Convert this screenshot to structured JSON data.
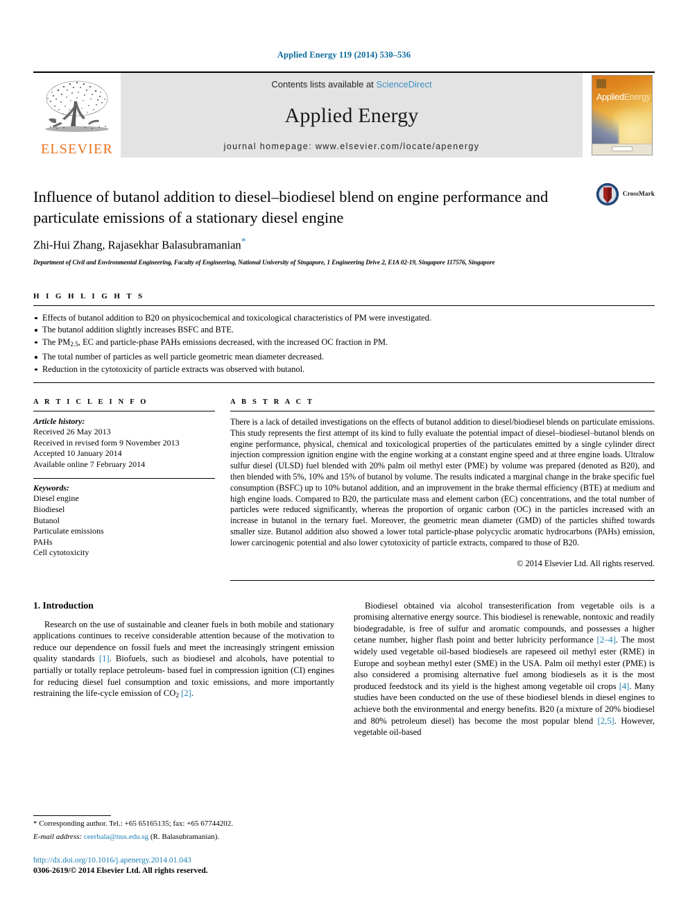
{
  "journal_ref": "Applied Energy 119 (2014) 530–536",
  "masthead": {
    "elsevier_wordmark": "ELSEVIER",
    "contents_prefix": "Contents lists available at ",
    "sciencedirect": "ScienceDirect",
    "journal_title": "Applied Energy",
    "homepage": "journal homepage: www.elsevier.com/locate/apenergy",
    "cover_title_a": "Applied",
    "cover_title_b": "Energy"
  },
  "article": {
    "title": "Influence of butanol addition to diesel–biodiesel blend on engine performance and particulate emissions of a stationary diesel engine",
    "authors": "Zhi-Hui Zhang, Rajasekhar Balasubramanian",
    "corresponding_mark": "*",
    "affiliation": "Department of Civil and Environmental Engineering, Faculty of Engineering, National University of Singapore, 1 Engineering Drive 2, E1A 02-19, Singapore 117576, Singapore",
    "crossmark_label": "CrossMark"
  },
  "highlights": {
    "heading": "H I G H L I G H T S",
    "items": [
      "Effects of butanol addition to B20 on physicochemical and toxicological characteristics of PM were investigated.",
      "The butanol addition slightly increases BSFC and BTE.",
      "The PM2.5, EC and particle-phase PAHs emissions decreased, with the increased OC fraction in PM.",
      "The total number of particles as well particle geometric mean diameter decreased.",
      "Reduction in the cytotoxicity of particle extracts was observed with butanol."
    ]
  },
  "article_info": {
    "heading": "A R T I C L E    I N F O",
    "history_label": "Article history:",
    "history": [
      "Received 26 May 2013",
      "Received in revised form 9 November 2013",
      "Accepted 10 January 2014",
      "Available online 7 February 2014"
    ],
    "keywords_label": "Keywords:",
    "keywords": [
      "Diesel engine",
      "Biodiesel",
      "Butanol",
      "Particulate emissions",
      "PAHs",
      "Cell cytotoxicity"
    ]
  },
  "abstract": {
    "heading": "A B S T R A C T",
    "text": "There is a lack of detailed investigations on the effects of butanol addition to diesel/biodiesel blends on particulate emissions. This study represents the first attempt of its kind to fully evaluate the potential impact of diesel–biodiesel–butanol blends on engine performance, physical, chemical and toxicological properties of the particulates emitted by a single cylinder direct injection compression ignition engine with the engine working at a constant engine speed and at three engine loads. Ultralow sulfur diesel (ULSD) fuel blended with 20% palm oil methyl ester (PME) by volume was prepared (denoted as B20), and then blended with 5%, 10% and 15% of butanol by volume. The results indicated a marginal change in the brake specific fuel consumption (BSFC) up to 10% butanol addition, and an improvement in the brake thermal efficiency (BTE) at medium and high engine loads. Compared to B20, the particulate mass and element carbon (EC) concentrations, and the total number of particles were reduced significantly, whereas the proportion of organic carbon (OC) in the particles increased with an increase in butanol in the ternary fuel. Moreover, the geometric mean diameter (GMD) of the particles shifted towards smaller size. Butanol addition also showed a lower total particle-phase polycyclic aromatic hydrocarbons (PAHs) emission, lower carcinogenic potential and also lower cytotoxicity of particle extracts, compared to those of B20.",
    "copyright": "© 2014 Elsevier Ltd. All rights reserved."
  },
  "body": {
    "section_heading": "1. Introduction",
    "left_paragraph_pre": "Research on the use of sustainable and cleaner fuels in both mobile and stationary applications continues to receive considerable attention because of the motivation to reduce our dependence on fossil fuels and meet the increasingly stringent emission quality standards ",
    "left_ref_1": "[1]",
    "left_paragraph_mid": ". Biofuels, such as biodiesel and alcohols, have potential to partially or totally replace petroleum- based fuel in compression ignition (CI) engines for reducing diesel fuel consumption and toxic emissions, and more importantly restraining the life-cycle emission of CO",
    "left_sub": "2",
    "left_space": " ",
    "left_ref_2": "[2]",
    "left_paragraph_end": ".",
    "right_paragraph_pre": "Biodiesel obtained via alcohol transesterification from vegetable oils is a promising alternative energy source. This biodiesel is renewable, nontoxic and readily biodegradable, is free of sulfur and aromatic compounds, and possesses a higher cetane number, higher flash point and better lubricity performance ",
    "right_ref_1": "[2–4]",
    "right_paragraph_mid1": ". The most widely used vegetable oil-based biodiesels are rapeseed oil methyl ester (RME) in Europe and soybean methyl ester (SME) in the USA. Palm oil methyl ester (PME) is also considered a promising alternative fuel among biodiesels as it is the most produced feedstock and its yield is the highest among vegetable oil crops ",
    "right_ref_2": "[4]",
    "right_paragraph_mid2": ". Many studies have been conducted on the use of these biodiesel blends in diesel engines to achieve both the environmental and energy benefits. B20 (a mixture of 20% biodiesel and 80% petroleum diesel) has become the most popular blend ",
    "right_ref_3": "[2,5]",
    "right_paragraph_end": ". However, vegetable oil-based"
  },
  "footnote": {
    "corresponding": "* Corresponding author. Tel.: +65 65165135; fax: +65 67744202.",
    "email_label": "E-mail address:",
    "email": "ceerbala@nus.edu.sg",
    "email_suffix": "(R. Balasubramanian)."
  },
  "footer": {
    "doi": "http://dx.doi.org/10.1016/j.apenergy.2014.01.043",
    "issn": "0306-2619/© 2014 Elsevier Ltd. All rights reserved."
  },
  "colors": {
    "link": "#1b7fb5",
    "journal_ref": "#0b6a9c",
    "elsevier_orange": "#E9711C",
    "sciencedirect": "#3e8ec0",
    "masthead_bg": "#e3e3e3"
  }
}
